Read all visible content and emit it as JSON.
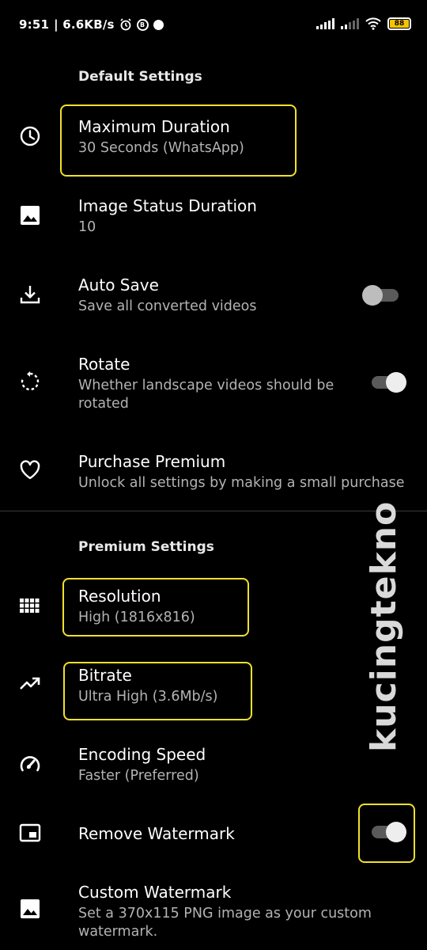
{
  "status_bar": {
    "time": "9:51",
    "network_speed": "| 6.6KB/s",
    "battery_level": "88",
    "icons": [
      "alarm-icon",
      "b-icon",
      "chat-bubble-icon",
      "signal-icon",
      "signal-icon",
      "wifi-icon",
      "battery-icon"
    ]
  },
  "default_section": {
    "header": "Default Settings",
    "items": [
      {
        "title": "Maximum Duration",
        "summary": "30 Seconds (WhatsApp)",
        "icon": "clock-icon"
      },
      {
        "title": "Image Status Duration",
        "summary": "10",
        "icon": "image-icon"
      },
      {
        "title": "Auto Save",
        "summary": "Save all converted videos",
        "icon": "download-icon",
        "toggle": "off"
      },
      {
        "title": "Rotate",
        "summary": "Whether landscape videos should be rotated",
        "icon": "rotate-icon",
        "toggle": "on"
      },
      {
        "title": "Purchase Premium",
        "summary": "Unlock all settings by making a small purchase",
        "icon": "heart-icon"
      }
    ]
  },
  "premium_section": {
    "header": "Premium Settings",
    "items": [
      {
        "title": "Resolution",
        "summary": "High (1816x816)",
        "icon": "grid-icon"
      },
      {
        "title": "Bitrate",
        "summary": "Ultra High (3.6Mb/s)",
        "icon": "trending-up-icon"
      },
      {
        "title": "Encoding Speed",
        "summary": "Faster (Preferred)",
        "icon": "speedometer-icon"
      },
      {
        "title": "Remove Watermark",
        "icon": "picture-in-picture-icon",
        "toggle": "on"
      },
      {
        "title": "Custom Watermark",
        "summary": "Set a 370x115 PNG image as your custom watermark.",
        "icon": "image-icon"
      }
    ]
  },
  "watermark_text": "kucingtekno",
  "colors": {
    "background": "#000000",
    "highlight": "#f2e12a",
    "summary_text": "#b3b3b3"
  }
}
